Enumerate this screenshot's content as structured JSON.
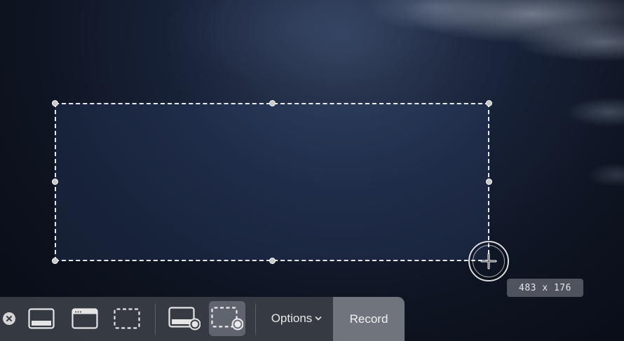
{
  "selection": {
    "dimensions_label": "483 x 176"
  },
  "toolbar": {
    "close_icon": "close-icon",
    "buttons": [
      {
        "name": "capture-entire-screen",
        "icon": "screen-icon"
      },
      {
        "name": "capture-window",
        "icon": "window-icon"
      },
      {
        "name": "capture-selection",
        "icon": "dashed-selection-icon"
      },
      {
        "name": "record-entire-screen",
        "icon": "screen-record-icon"
      },
      {
        "name": "record-selection",
        "icon": "selection-record-icon",
        "selected": true
      }
    ],
    "options_label": "Options",
    "record_label": "Record"
  },
  "colors": {
    "toolbar_bg": "#3a3e46",
    "selection_border": "#ffffff",
    "record_bg": "#969ba5"
  }
}
